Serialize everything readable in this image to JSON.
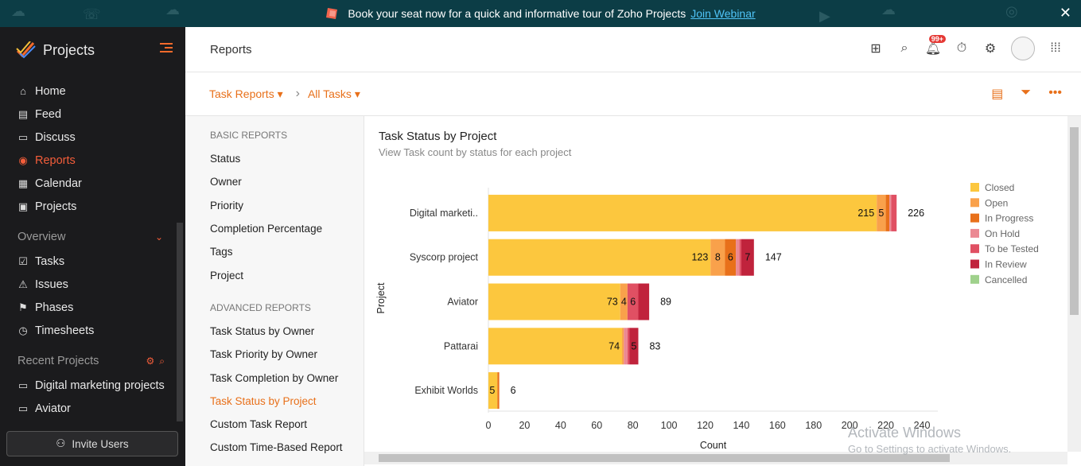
{
  "banner": {
    "text": "Book your seat now for a quick and informative tour of Zoho Projects",
    "link": "Join Webinar",
    "close_icon": "close-icon"
  },
  "sidebar": {
    "brand": "Projects",
    "items": [
      {
        "label": "Home",
        "icon": "home-icon"
      },
      {
        "label": "Feed",
        "icon": "feed-icon"
      },
      {
        "label": "Discuss",
        "icon": "discuss-icon"
      },
      {
        "label": "Reports",
        "icon": "reports-icon",
        "active": true
      },
      {
        "label": "Calendar",
        "icon": "calendar-icon"
      },
      {
        "label": "Projects",
        "icon": "projects-icon"
      }
    ],
    "overview_label": "Overview",
    "overview_items": [
      {
        "label": "Tasks",
        "icon": "tasks-icon"
      },
      {
        "label": "Issues",
        "icon": "issues-icon"
      },
      {
        "label": "Phases",
        "icon": "phases-icon"
      },
      {
        "label": "Timesheets",
        "icon": "timesheets-icon"
      }
    ],
    "recent_label": "Recent Projects",
    "recent_items": [
      {
        "label": "Digital marketing projects",
        "icon": "project-icon"
      },
      {
        "label": "Aviator",
        "icon": "project-icon"
      }
    ],
    "invite_label": "Invite Users",
    "accent": "#f35d3a"
  },
  "header": {
    "title": "Reports",
    "notification_badge": "99+"
  },
  "subheader": {
    "crumb1": "Task Reports",
    "crumb2": "All Tasks"
  },
  "reports": {
    "basic_heading": "BASIC REPORTS",
    "basic": [
      "Status",
      "Owner",
      "Priority",
      "Completion Percentage",
      "Tags",
      "Project"
    ],
    "advanced_heading": "ADVANCED REPORTS",
    "advanced": [
      "Task Status by Owner",
      "Task Priority by Owner",
      "Task Completion by Owner",
      "Task Status by Project",
      "Custom Task Report",
      "Custom Time-Based Report"
    ],
    "active": "Task Status by Project"
  },
  "chart_title": "Task Status by Project",
  "chart_subtitle": "View Task count by status for each project",
  "chart_data": {
    "type": "bar",
    "orientation": "horizontal",
    "stacked": true,
    "xlabel": "Count",
    "ylabel": "Project",
    "xlim": [
      0,
      240
    ],
    "xticks": [
      0,
      20,
      40,
      60,
      80,
      100,
      120,
      140,
      160,
      180,
      200,
      220,
      240
    ],
    "categories": [
      "Digital marketi..",
      "Syscorp project",
      "Aviator",
      "Pattarai",
      "Exhibit Worlds"
    ],
    "totals": [
      226,
      147,
      89,
      83,
      6
    ],
    "series": [
      {
        "name": "Closed",
        "color": "#fcc73e",
        "values": [
          215,
          123,
          73,
          74,
          5
        ]
      },
      {
        "name": "Open",
        "color": "#f9a14b",
        "values": [
          5,
          8,
          4,
          1,
          0
        ]
      },
      {
        "name": "In Progress",
        "color": "#e8701a",
        "values": [
          2,
          6,
          0,
          0,
          1
        ]
      },
      {
        "name": "On Hold",
        "color": "#eb8993",
        "values": [
          1,
          2,
          0,
          2,
          0
        ]
      },
      {
        "name": "To be Tested",
        "color": "#e05063",
        "values": [
          3,
          1,
          6,
          1,
          0
        ]
      },
      {
        "name": "In Review",
        "color": "#c0233c",
        "values": [
          0,
          7,
          6,
          5,
          0
        ]
      },
      {
        "name": "Cancelled",
        "color": "#9fd18c",
        "values": [
          0,
          0,
          0,
          0,
          0
        ]
      }
    ],
    "segment_labels": [
      [
        "215",
        "5",
        "",
        "",
        "",
        "",
        ""
      ],
      [
        "123",
        "8",
        "6",
        "",
        "",
        "7",
        ""
      ],
      [
        "73",
        "4",
        "",
        "",
        "6",
        "",
        ""
      ],
      [
        "74",
        "",
        "",
        "",
        "",
        "5",
        ""
      ],
      [
        "5",
        "",
        "",
        "",
        "",
        "",
        ""
      ]
    ],
    "legend": "right",
    "grid": false
  },
  "watermark": {
    "line1": "Activate Windows",
    "line2": "Go to Settings to activate Windows."
  }
}
